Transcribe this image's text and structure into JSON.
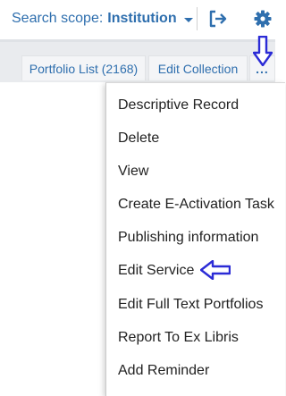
{
  "header": {
    "search_scope_label": "Search scope:",
    "search_scope_value": "Institution",
    "icons": [
      "logout-icon",
      "gear-icon"
    ]
  },
  "actions": {
    "portfolio_list": "Portfolio List (2168)",
    "edit_collection": "Edit Collection",
    "more": "..."
  },
  "menu": {
    "items": [
      "Descriptive Record",
      "Delete",
      "View",
      "Create E-Activation Task",
      "Publishing information",
      "Edit Service",
      "Edit Full Text Portfolios",
      "Report To Ex Libris",
      "Add Reminder"
    ]
  },
  "annotations": {
    "arrow_color": "#2b2bd6",
    "accent_color": "#2f6fae"
  }
}
